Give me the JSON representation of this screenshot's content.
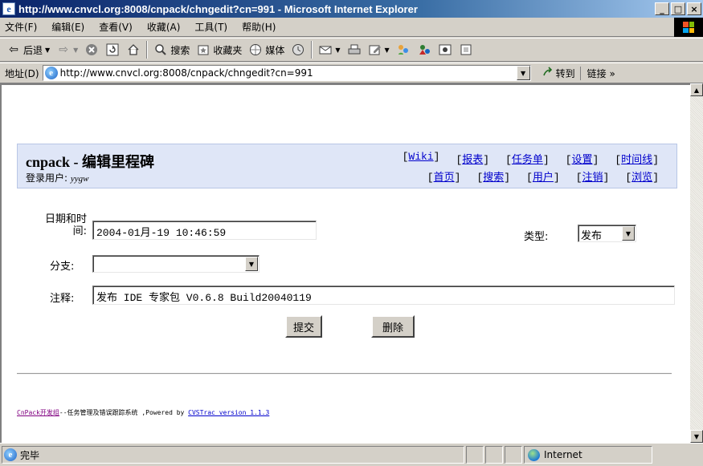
{
  "window": {
    "title": "http://www.cnvcl.org:8008/cnpack/chngedit?cn=991 - Microsoft Internet Explorer",
    "minimize": "_",
    "maximize": "□",
    "close": "×"
  },
  "menu": [
    "文件(F)",
    "编辑(E)",
    "查看(V)",
    "收藏(A)",
    "工具(T)",
    "帮助(H)"
  ],
  "toolbar": {
    "back": "后退",
    "search": "搜索",
    "favorites": "收藏夹",
    "media": "媒体"
  },
  "address": {
    "label": "地址(D)",
    "url": "http://www.cnvcl.org:8008/cnpack/chngedit?cn=991",
    "go": "转到",
    "links": "链接 »"
  },
  "page": {
    "app_title": "cnpack - 编辑里程碑",
    "login_label": "登录用户:",
    "login_user": "yygw",
    "nav_row1": [
      "Wiki",
      "报表",
      "任务单",
      "设置",
      "时间线"
    ],
    "nav_row2": [
      "首页",
      "搜索",
      "用户",
      "注销",
      "浏览"
    ],
    "form": {
      "datetime_label_line1": "日期和时",
      "datetime_label_line2": "间:",
      "datetime_value": "2004-01月-19 10:46:59",
      "type_label": "类型:",
      "type_value": "发布",
      "branch_label": "分支:",
      "branch_value": "",
      "comment_label": "注释:",
      "comment_value": "发布 IDE 专家包 V0.6.8 Build20040119",
      "submit": "提交",
      "delete": "删除"
    },
    "footer": {
      "link_team": "CnPack开发组",
      "mid_text": "--任务管理及错误跟踪系统 ,Powered by ",
      "link_version": "CVSTrac version 1.1.3"
    }
  },
  "status": {
    "text": "完毕",
    "zone": "Internet"
  },
  "colors": {
    "title_blue": "#0a246a",
    "header_bg": "#dfe6f7",
    "link_blue": "#0000cc",
    "visited_purple": "#800080"
  }
}
